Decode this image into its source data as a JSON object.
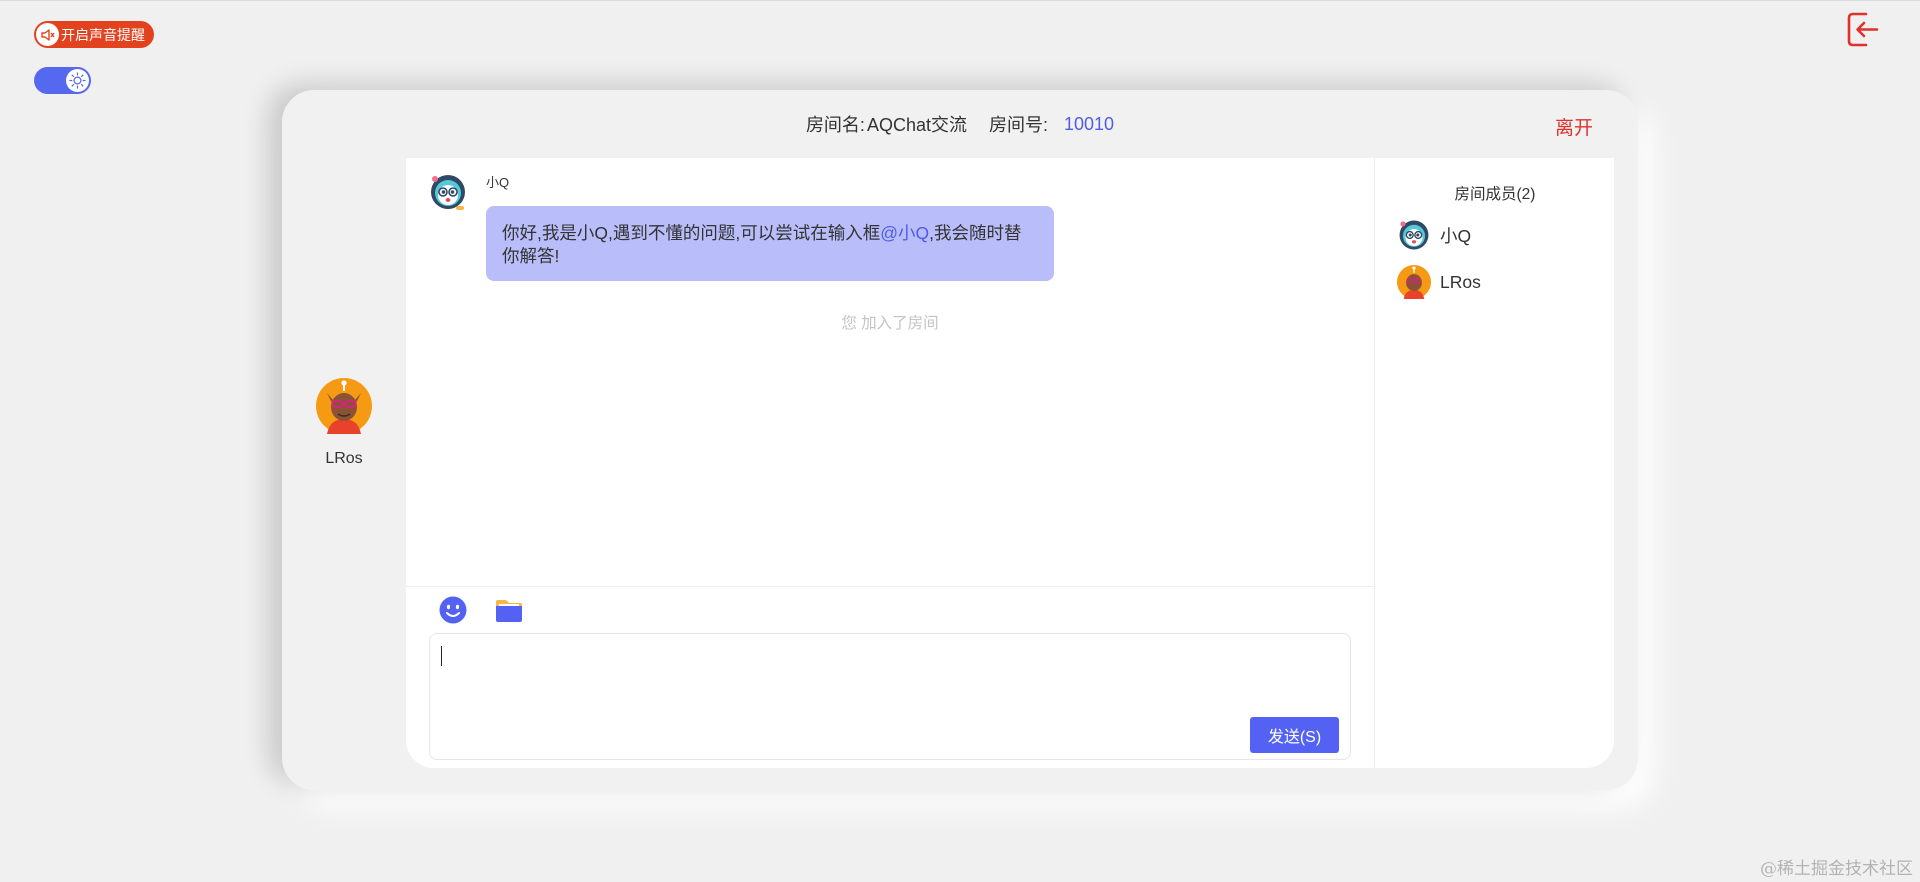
{
  "controls": {
    "sound_reminder_label": "开启声音提醒"
  },
  "room": {
    "name_label": "房间名:",
    "name": "AQChat交流",
    "id_label": "房间号:",
    "id": "10010",
    "leave_label": "离开"
  },
  "current_user": {
    "name": "LRos"
  },
  "messages": [
    {
      "sender": "小Q",
      "text_before": "你好,我是小Q,遇到不懂的问题,可以尝试在输入框",
      "mention": "@小Q",
      "text_after": ",我会随时替你解答!"
    }
  ],
  "system_note": "您 加入了房间",
  "input": {
    "send_label": "发送(S)"
  },
  "members": {
    "title": "房间成员(2)",
    "list": [
      {
        "name": "小Q"
      },
      {
        "name": "LRos"
      }
    ]
  },
  "watermark": "@稀土掘金技术社区",
  "colors": {
    "accent": "#5462f4",
    "bubble": "#b9befb",
    "danger": "#e0312b",
    "sound_button": "#e3421f"
  }
}
